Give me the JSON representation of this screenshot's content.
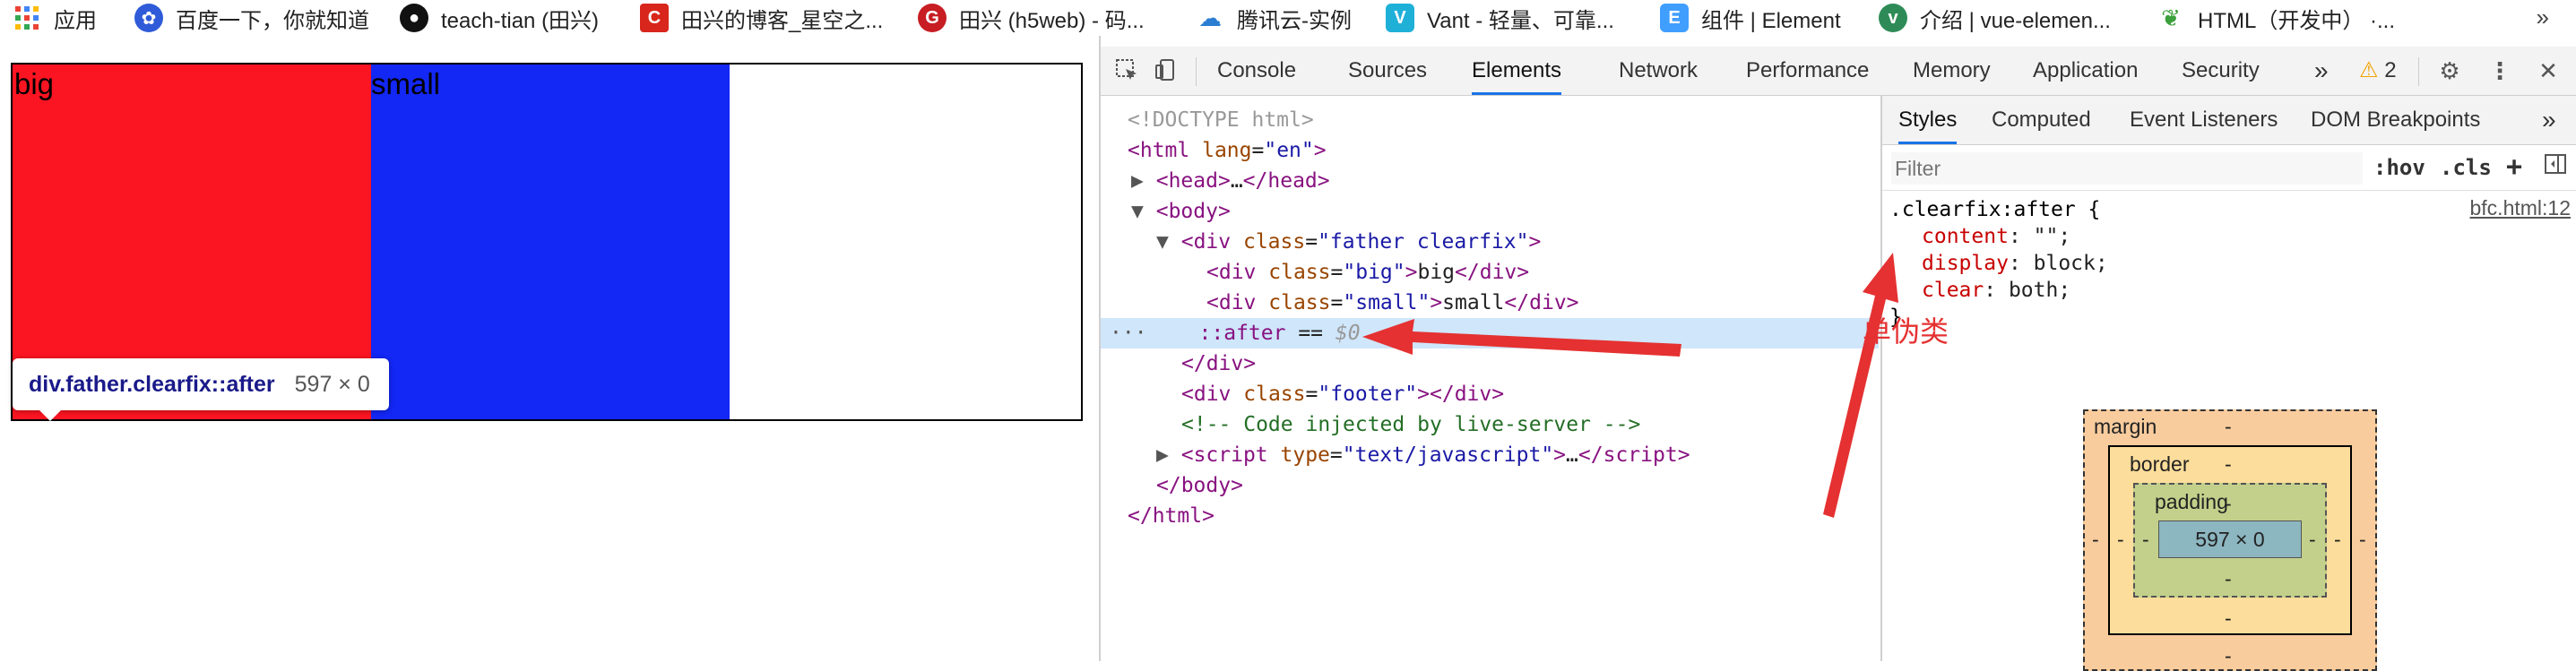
{
  "bookmarks": [
    {
      "label": "应用",
      "icon": "apps-grid-icon"
    },
    {
      "label": "百度一下，你就知道",
      "icon": "baidu-paw-icon"
    },
    {
      "label": "teach-tian (田兴)",
      "icon": "github-icon"
    },
    {
      "label": "田兴的博客_星空之...",
      "icon": "csdn-icon"
    },
    {
      "label": "田兴 (h5web) - 码...",
      "icon": "gitee-icon"
    },
    {
      "label": "腾讯云-实例",
      "icon": "tencent-cloud-icon"
    },
    {
      "label": "Vant - 轻量、可靠...",
      "icon": "vant-icon"
    },
    {
      "label": "组件 | Element",
      "icon": "element-icon"
    },
    {
      "label": "介绍 | vue-elemen...",
      "icon": "vue-element-icon"
    },
    {
      "label": "HTML（开发中） ·...",
      "icon": "html-leaf-icon"
    }
  ],
  "bookmarks_more": "»",
  "page": {
    "big_text": "big",
    "small_text": "small",
    "tooltip": {
      "name": "div.father.clearfix::after",
      "size": "597 × 0"
    }
  },
  "devtools": {
    "tabs": [
      "Console",
      "Sources",
      "Elements",
      "Network",
      "Performance",
      "Memory",
      "Application",
      "Security"
    ],
    "active_tab": "Elements",
    "more_tabs": "»",
    "warnings": "2",
    "close": "✕",
    "dom": {
      "doctype": "<!DOCTYPE html>",
      "html_open": "html",
      "html_attr": "lang",
      "html_val": "\"en\"",
      "head": "head",
      "head_ellipsis": "…",
      "body": "body",
      "div_father": "div",
      "father_attr": "class",
      "father_val": "\"father clearfix\"",
      "big_val": "\"big\"",
      "big_text": "big",
      "small_val": "\"small\"",
      "small_text": "small",
      "after": "::after",
      "after_eq": " == ",
      "after_ref": "$0",
      "div_close": "/div",
      "footer_val": "\"footer\"",
      "comment": "<!-- Code injected by live-server -->",
      "script": "script",
      "script_attr": "type",
      "script_val": "\"text/javascript\"",
      "script_ellipsis": "…",
      "body_close": "/body",
      "html_close": "/html",
      "gutter": "···"
    },
    "styles": {
      "tabs": [
        "Styles",
        "Computed",
        "Event Listeners",
        "DOM Breakpoints"
      ],
      "active_tab": "Styles",
      "more_tabs": "»",
      "filter_placeholder": "Filter",
      "hov": ":hov",
      "cls": ".cls",
      "plus": "+",
      "rule_selector": ".clearfix:after {",
      "rule_source": "bfc.html:12",
      "props": [
        {
          "name": "content",
          "value": "\"\";"
        },
        {
          "name": "display",
          "value": "block;"
        },
        {
          "name": "clear",
          "value": "both;"
        }
      ],
      "rule_close": "}"
    },
    "box_model": {
      "margin_label": "margin",
      "margin_top": "-",
      "margin_left": "-",
      "margin_right": "-",
      "margin_bottom": "-",
      "border_label": "border",
      "border_top": "-",
      "border_left": "-",
      "border_right": "-",
      "border_bottom": "-",
      "padding_label": "padding",
      "padding_top": "-",
      "padding_left": "-",
      "padding_right": "-",
      "padding_bottom": "-",
      "content": "597 × 0"
    }
  },
  "annotation": {
    "label": "单伪类",
    "color": "#e53131"
  }
}
